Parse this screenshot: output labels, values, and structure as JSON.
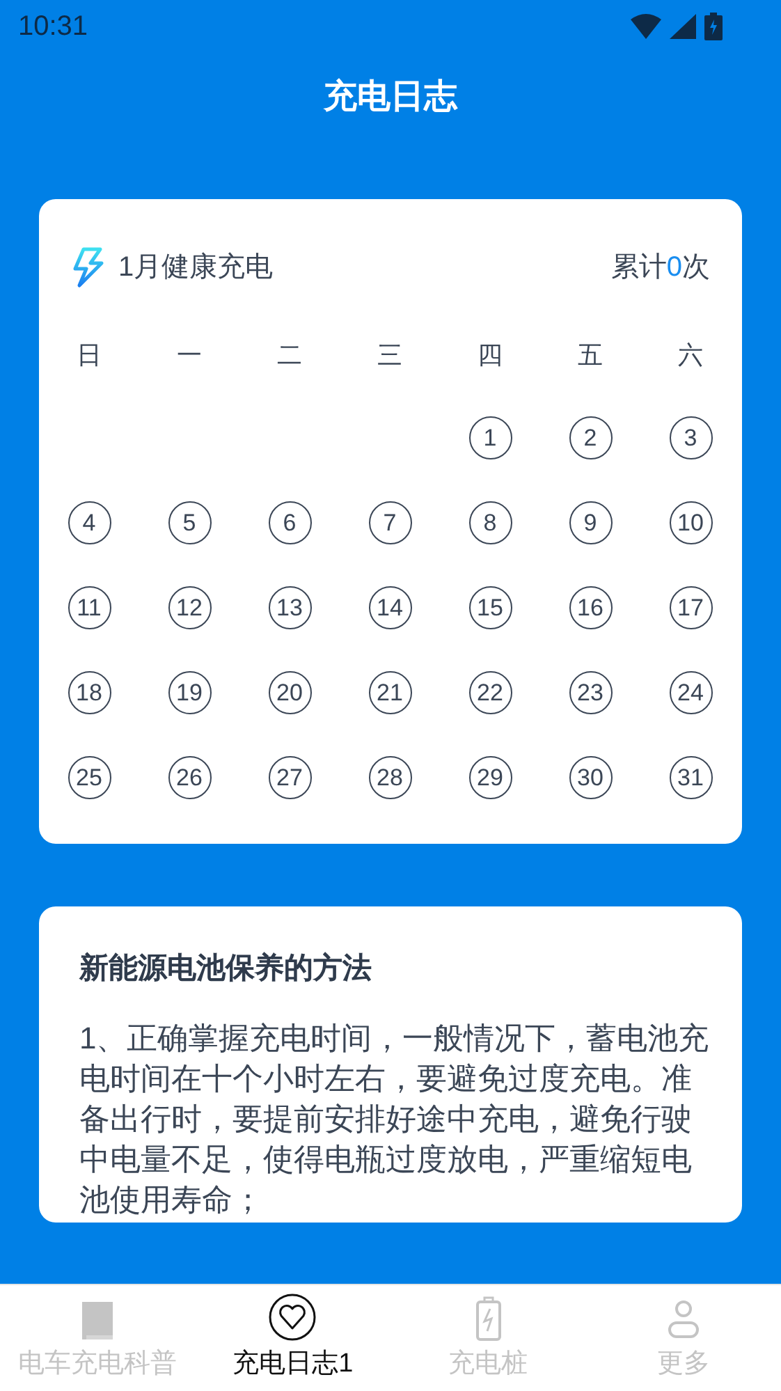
{
  "status_bar": {
    "time": "10:31"
  },
  "title": "充电日志",
  "calendar": {
    "heading": "1月健康充电",
    "total_prefix": "累计",
    "total_count": "0",
    "total_suffix": "次",
    "weekdays": [
      "日",
      "一",
      "二",
      "三",
      "四",
      "五",
      "六"
    ],
    "weeks": [
      {
        "kind": "partial_start",
        "days": [
          "1",
          "2",
          "3"
        ]
      },
      {
        "kind": "full",
        "days": [
          "4",
          "5",
          "6",
          "7",
          "8",
          "9",
          "10"
        ]
      },
      {
        "kind": "full",
        "days": [
          "11",
          "12",
          "13",
          "14",
          "15",
          "16",
          "17"
        ]
      },
      {
        "kind": "full",
        "days": [
          "18",
          "19",
          "20",
          "21",
          "22",
          "23",
          "24"
        ]
      },
      {
        "kind": "full",
        "days": [
          "25",
          "26",
          "27",
          "28",
          "29",
          "30",
          "31"
        ]
      }
    ]
  },
  "article": {
    "title": "新能源电池保养的方法",
    "body": "1、正确掌握充电时间，一般情况下，蓄电池充电时间在十个小时左右，要避免过度充电。准备出行时，要提前安排好途中充电，避免行驶中电量不足，使得电瓶过度放电，严重缩短电池使用寿命；"
  },
  "tabs": [
    {
      "label": "电车充电科普",
      "kind": "book",
      "selected": false
    },
    {
      "label": "充电日志1",
      "kind": "heart",
      "selected": true
    },
    {
      "label": "充电桩",
      "kind": "battery",
      "selected": false
    },
    {
      "label": "更多",
      "kind": "person",
      "selected": false
    }
  ]
}
